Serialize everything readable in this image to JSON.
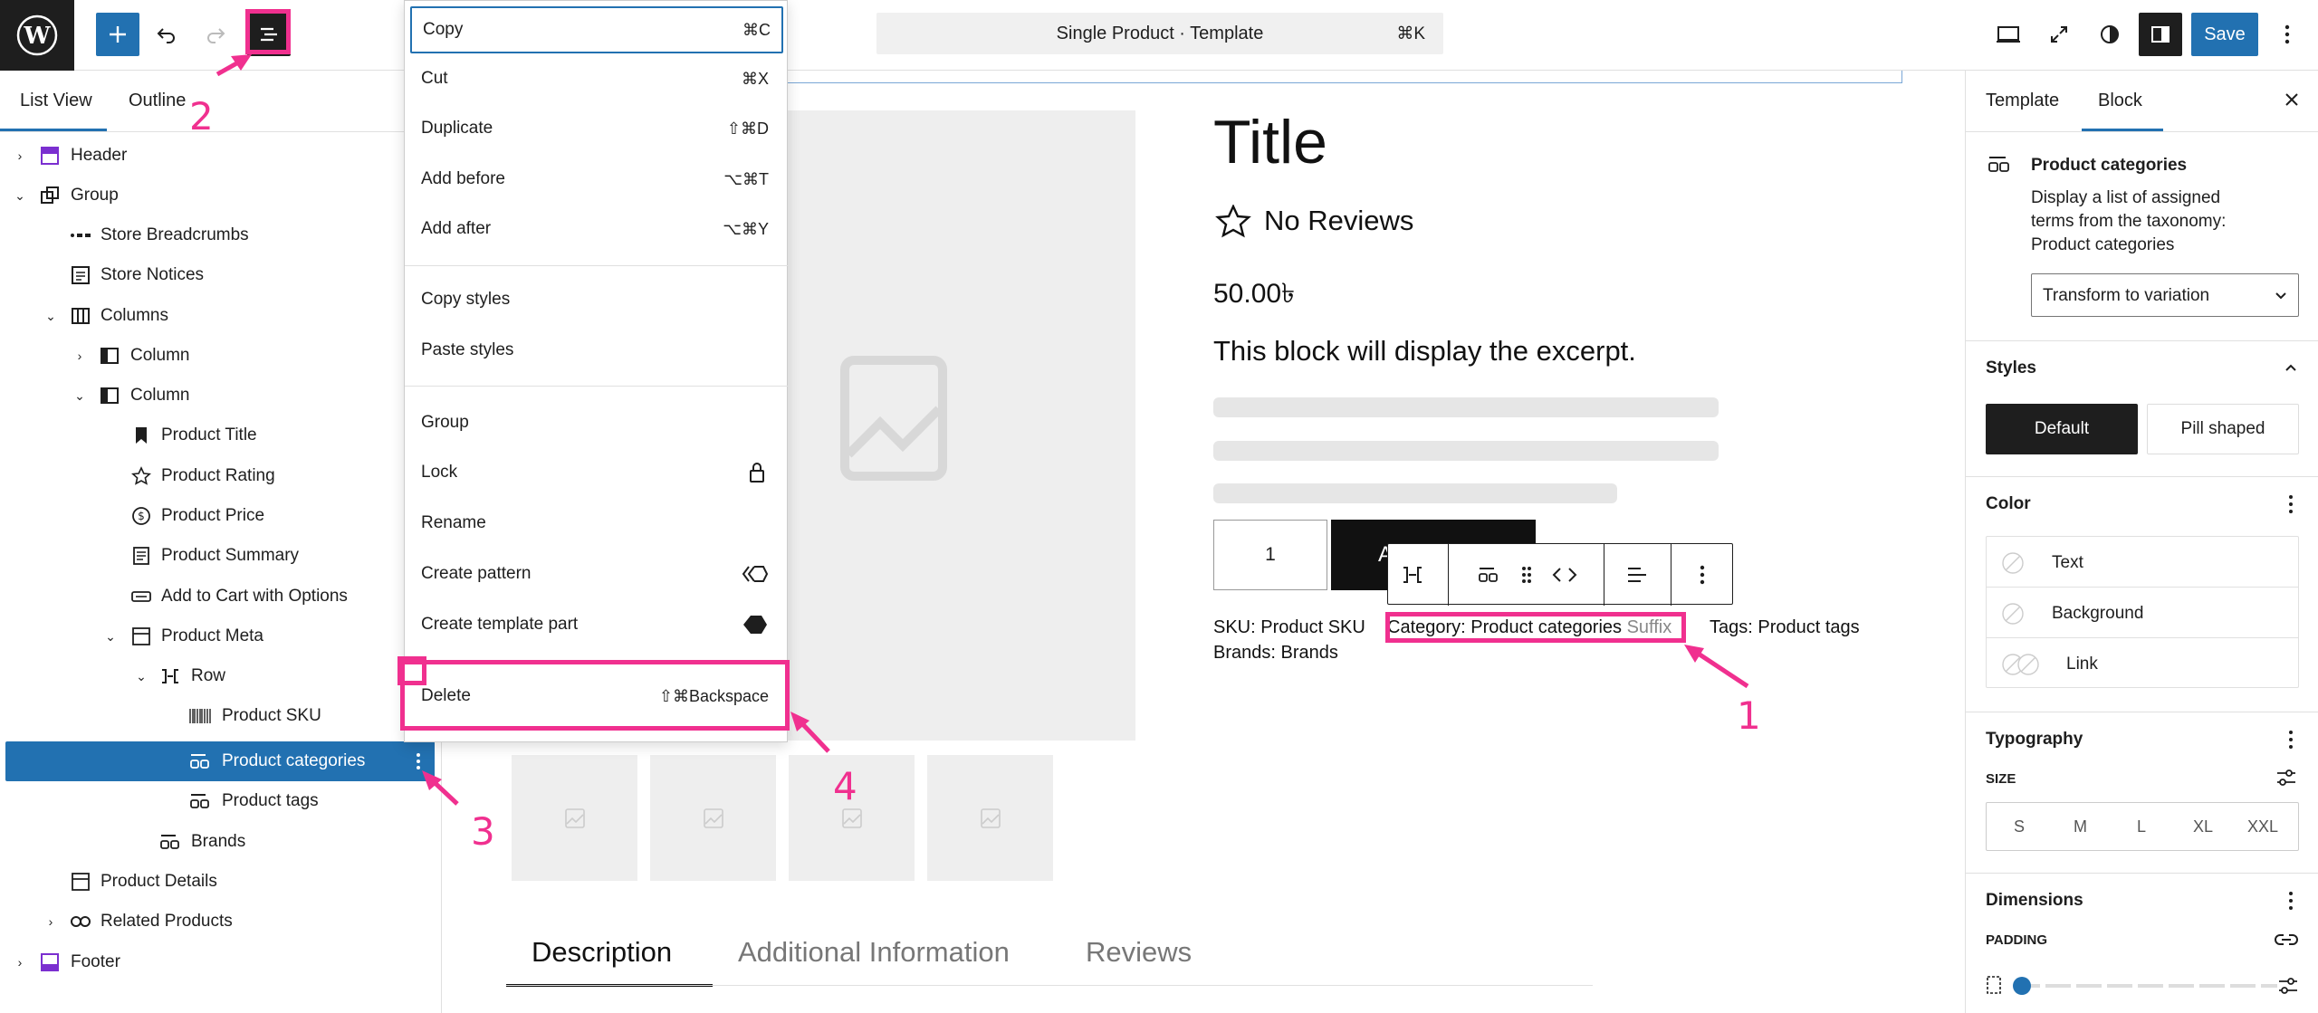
{
  "topbar": {
    "command_title": "Single Product · Template",
    "command_shortcut": "⌘K",
    "save_label": "Save"
  },
  "left_panel": {
    "tabs": [
      "List View",
      "Outline"
    ],
    "tree": [
      {
        "label": "Header",
        "icon": "header-icon"
      },
      {
        "label": "Group",
        "icon": "group-icon"
      },
      {
        "label": "Store Breadcrumbs",
        "icon": "breadcrumbs-icon"
      },
      {
        "label": "Store Notices",
        "icon": "notices-icon"
      },
      {
        "label": "Columns",
        "icon": "columns-icon"
      },
      {
        "label": "Column",
        "icon": "column-icon"
      },
      {
        "label": "Column",
        "icon": "column-icon"
      },
      {
        "label": "Product Title",
        "icon": "bookmark-icon"
      },
      {
        "label": "Product Rating",
        "icon": "star-icon"
      },
      {
        "label": "Product Price",
        "icon": "dollar-icon"
      },
      {
        "label": "Product Summary",
        "icon": "summary-icon"
      },
      {
        "label": "Add to Cart with Options",
        "icon": "button-icon"
      },
      {
        "label": "Product Meta",
        "icon": "meta-icon"
      },
      {
        "label": "Row",
        "icon": "row-icon"
      },
      {
        "label": "Product SKU",
        "icon": "barcode-icon"
      },
      {
        "label": "Product categories",
        "icon": "terms-icon"
      },
      {
        "label": "Product tags",
        "icon": "terms-icon"
      },
      {
        "label": "Brands",
        "icon": "terms-icon"
      },
      {
        "label": "Product Details",
        "icon": "details-icon"
      },
      {
        "label": "Related Products",
        "icon": "link-icon"
      },
      {
        "label": "Footer",
        "icon": "footer-icon"
      }
    ]
  },
  "context_menu": {
    "group1": [
      {
        "label": "Copy",
        "shortcut": "⌘C"
      },
      {
        "label": "Cut",
        "shortcut": "⌘X"
      },
      {
        "label": "Duplicate",
        "shortcut": "⇧⌘D"
      },
      {
        "label": "Add before",
        "shortcut": "⌥⌘T"
      },
      {
        "label": "Add after",
        "shortcut": "⌥⌘Y"
      }
    ],
    "group2": [
      {
        "label": "Copy styles"
      },
      {
        "label": "Paste styles"
      }
    ],
    "group3": [
      {
        "label": "Group"
      },
      {
        "label": "Lock"
      },
      {
        "label": "Rename"
      },
      {
        "label": "Create pattern"
      },
      {
        "label": "Create template part"
      }
    ],
    "delete": {
      "label": "Delete",
      "shortcut": "⇧⌘Backspace"
    }
  },
  "canvas": {
    "title": "Title",
    "reviews": "No Reviews",
    "price": "50.00৳",
    "excerpt": "This block will display the excerpt.",
    "quantity": "1",
    "add_to_cart": "Ad",
    "sku": "SKU: Product SKU",
    "brands": "Brands: Brands",
    "category_prefix": "Category: Product categories",
    "category_suffix": "Suffix",
    "tags": "Tags: Product tags",
    "tabs": [
      "Description",
      "Additional Information",
      "Reviews"
    ]
  },
  "right_panel": {
    "tabs": [
      "Template",
      "Block"
    ],
    "block_name": "Product categories",
    "block_desc": [
      "Display a list of assigned",
      "terms from the taxonomy:",
      "Product categories"
    ],
    "transform_label": "Transform to variation",
    "styles_title": "Styles",
    "style_default": "Default",
    "style_pill": "Pill shaped",
    "color_title": "Color",
    "color_items": [
      "Text",
      "Background",
      "Link"
    ],
    "typography_title": "Typography",
    "size_label": "SIZE",
    "sizes": [
      "S",
      "M",
      "L",
      "XL",
      "XXL"
    ],
    "dimensions_title": "Dimensions",
    "padding_label": "PADDING"
  },
  "annotations": [
    "1",
    "2",
    "3",
    "4"
  ],
  "colors": {
    "accent": "#2271b1",
    "annotation": "#f0308f"
  }
}
